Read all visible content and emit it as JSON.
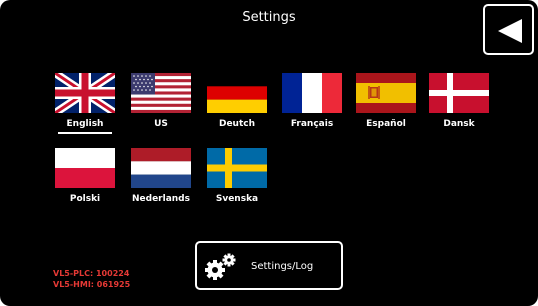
{
  "header": {
    "title": "Settings"
  },
  "back_button": {
    "icon": "back-arrow-icon"
  },
  "languages": [
    {
      "label": "English",
      "flag": "uk",
      "selected": true
    },
    {
      "label": "US",
      "flag": "us",
      "selected": false
    },
    {
      "label": "Deutch",
      "flag": "de",
      "selected": false
    },
    {
      "label": "Français",
      "flag": "fr",
      "selected": false
    },
    {
      "label": "Español",
      "flag": "es",
      "selected": false
    },
    {
      "label": "Dansk",
      "flag": "dk",
      "selected": false
    },
    {
      "label": "Polski",
      "flag": "pl",
      "selected": false
    },
    {
      "label": "Nederlands",
      "flag": "nl",
      "selected": false
    },
    {
      "label": "Svenska",
      "flag": "se",
      "selected": false
    }
  ],
  "settings_log_button": {
    "label": "Settings/Log",
    "icon": "gears-icon"
  },
  "version": {
    "plc": "VL5-PLC: 100224",
    "hmi": "VL5-HMI: 061925"
  },
  "colors": {
    "background": "#000000",
    "foreground": "#ffffff",
    "version_text": "#e53935"
  }
}
